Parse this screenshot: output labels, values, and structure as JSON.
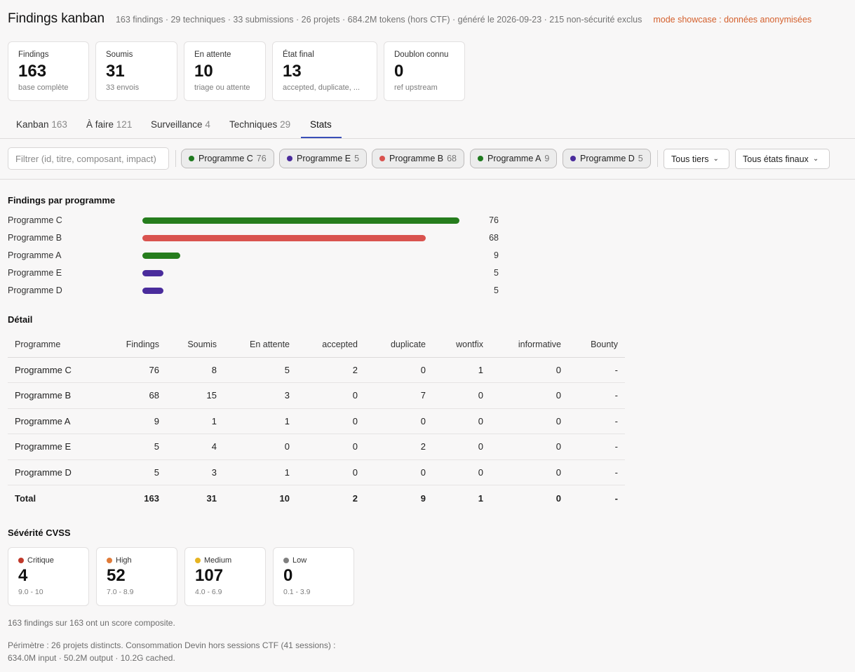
{
  "header": {
    "title": "Findings kanban",
    "meta": "163 findings · 29 techniques · 33 submissions · 26 projets · 684.2M tokens (hors CTF) · généré le 2026-09-23 · 215 non-sécurité exclus",
    "showcase": "mode showcase : données anonymisées"
  },
  "cards": [
    {
      "label": "Findings",
      "value": "163",
      "sub": "base complète"
    },
    {
      "label": "Soumis",
      "value": "31",
      "sub": "33 envois"
    },
    {
      "label": "En attente",
      "value": "10",
      "sub": "triage ou attente"
    },
    {
      "label": "État final",
      "value": "13",
      "sub": "accepted, duplicate, ..."
    },
    {
      "label": "Doublon connu",
      "value": "0",
      "sub": "ref upstream"
    }
  ],
  "tabs": [
    {
      "label": "Kanban",
      "count": "163"
    },
    {
      "label": "À faire",
      "count": "121"
    },
    {
      "label": "Surveillance",
      "count": "4"
    },
    {
      "label": "Techniques",
      "count": "29"
    },
    {
      "label": "Stats",
      "count": ""
    }
  ],
  "filter": {
    "placeholder": "Filtrer (id, titre, composant, impact)"
  },
  "chips": [
    {
      "label": "Programme C",
      "count": "76",
      "color": "#1f7a1f"
    },
    {
      "label": "Programme E",
      "count": "5",
      "color": "#4a2c9c"
    },
    {
      "label": "Programme B",
      "count": "68",
      "color": "#d9534f"
    },
    {
      "label": "Programme A",
      "count": "9",
      "color": "#1f7a1f"
    },
    {
      "label": "Programme D",
      "count": "5",
      "color": "#4a2c9c"
    }
  ],
  "selects": {
    "tiers": "Tous tiers",
    "etats": "Tous états finaux"
  },
  "bars_title": "Findings par programme",
  "chart_data": {
    "type": "bar",
    "categories": [
      "Programme C",
      "Programme B",
      "Programme A",
      "Programme E",
      "Programme D"
    ],
    "values": [
      76,
      68,
      9,
      5,
      5
    ],
    "colors": [
      "#267d1d",
      "#d9534f",
      "#267d1d",
      "#4a2c9c",
      "#4a2c9c"
    ],
    "title": "Findings par programme"
  },
  "detail": {
    "title": "Détail",
    "headers": [
      "Programme",
      "Findings",
      "Soumis",
      "En attente",
      "accepted",
      "duplicate",
      "wontfix",
      "informative",
      "Bounty"
    ],
    "rows": [
      [
        "Programme C",
        "76",
        "8",
        "5",
        "2",
        "0",
        "1",
        "0",
        "-"
      ],
      [
        "Programme B",
        "68",
        "15",
        "3",
        "0",
        "7",
        "0",
        "0",
        "-"
      ],
      [
        "Programme A",
        "9",
        "1",
        "1",
        "0",
        "0",
        "0",
        "0",
        "-"
      ],
      [
        "Programme E",
        "5",
        "4",
        "0",
        "0",
        "2",
        "0",
        "0",
        "-"
      ],
      [
        "Programme D",
        "5",
        "3",
        "1",
        "0",
        "0",
        "0",
        "0",
        "-"
      ]
    ],
    "total": [
      "Total",
      "163",
      "31",
      "10",
      "2",
      "9",
      "1",
      "0",
      "-"
    ]
  },
  "severity": {
    "title": "Sévérité CVSS",
    "items": [
      {
        "label": "Critique",
        "value": "4",
        "range": "9.0 - 10",
        "color": "#c0392b"
      },
      {
        "label": "High",
        "value": "52",
        "range": "7.0 - 8.9",
        "color": "#e07b39"
      },
      {
        "label": "Medium",
        "value": "107",
        "range": "4.0 - 6.9",
        "color": "#e6b422"
      },
      {
        "label": "Low",
        "value": "0",
        "range": "0.1 - 3.9",
        "color": "#808080"
      }
    ]
  },
  "notes": {
    "composite": "163 findings sur 163 ont un score composite.",
    "perimetre_line1": "Périmètre : 26 projets distincts. Consommation Devin hors sessions CTF (41 sessions) :",
    "perimetre_line2": "634.0M input · 50.2M output · 10.2G cached."
  }
}
